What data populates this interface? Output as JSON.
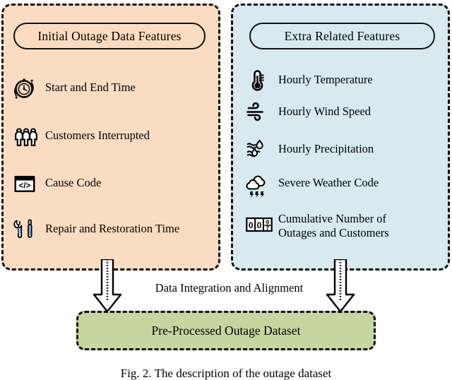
{
  "colors": {
    "left_panel_fill": "#fadcc2",
    "right_panel_fill": "#d8e9f0",
    "output_box_fill": "#c5d6a0",
    "outline": "#111111",
    "tool_accent_blue": "#5b9bd5"
  },
  "left_panel": {
    "title": "Initial Outage Data Features",
    "features": [
      {
        "icon": "stopwatch-clock-icon",
        "label": "Start and End Time"
      },
      {
        "icon": "people-group-icon",
        "label": "Customers Interrupted"
      },
      {
        "icon": "code-window-icon",
        "label": "Cause Code"
      },
      {
        "icon": "wrench-screwdriver-icon",
        "label": "Repair and Restoration Time"
      }
    ]
  },
  "right_panel": {
    "title": "Extra Related Features",
    "features": [
      {
        "icon": "thermometer-icon",
        "label": "Hourly Temperature"
      },
      {
        "icon": "wind-icon",
        "label": "Hourly Wind Speed"
      },
      {
        "icon": "precipitation-droplets-icon",
        "label": "Hourly Precipitation"
      },
      {
        "icon": "storm-cloud-lightning-icon",
        "label": "Severe Weather Code"
      },
      {
        "icon": "odometer-counter-icon",
        "label": "Cumulative Number of\nOutages and Customers"
      }
    ]
  },
  "flow": {
    "integration_label": "Data Integration and Alignment",
    "arrow_left": "down-arrow-icon",
    "arrow_right": "down-arrow-icon"
  },
  "output": {
    "label": "Pre-Processed Outage Dataset"
  },
  "caption": {
    "text": "Fig. 2.  The description of the outage dataset"
  }
}
